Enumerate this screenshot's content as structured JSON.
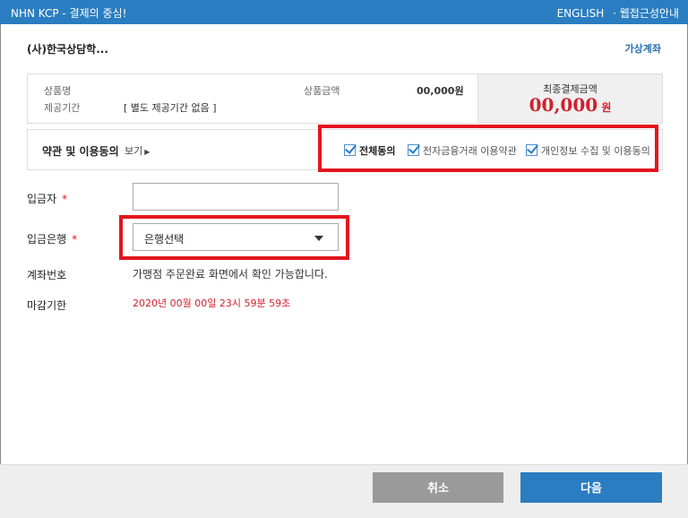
{
  "window": {
    "title": "NHN KCP - 결제의 중심!",
    "english_link": "ENGLISH",
    "accessibility_link": "· 웹접근성안내"
  },
  "merchant": {
    "name": "(사)한국상담학...",
    "payment_method": "가상계좌"
  },
  "product": {
    "name_label": "상품명",
    "period_label": "제공기간",
    "period_value": "[ 별도 제공기간 없음 ]",
    "amount_label": "상품금액",
    "amount_value": "00,000원",
    "final_label": "최종결제금액",
    "final_amount": "00,000",
    "final_unit": "원"
  },
  "terms": {
    "title": "약관 및 이용동의",
    "view_link": "보기",
    "agree_all": "전체동의",
    "agree_efinance": "전자금융거래 이용약관",
    "agree_privacy": "개인정보 수집 및 이용동의"
  },
  "form": {
    "depositor_label": "입금자",
    "bank_label": "입금은행",
    "bank_selected": "은행선택",
    "account_label": "계좌번호",
    "account_note": "가맹점 주문완료 화면에서 확인 가능합니다.",
    "deadline_label": "마감기한",
    "deadline_value": "2020년 00월 00일 23시 59분 59초",
    "required_mark": "*"
  },
  "buttons": {
    "cancel": "취소",
    "next": "다음"
  },
  "colors": {
    "brand": "#2a7dc0",
    "highlight": "#e3151f",
    "amount": "#d0202a"
  }
}
